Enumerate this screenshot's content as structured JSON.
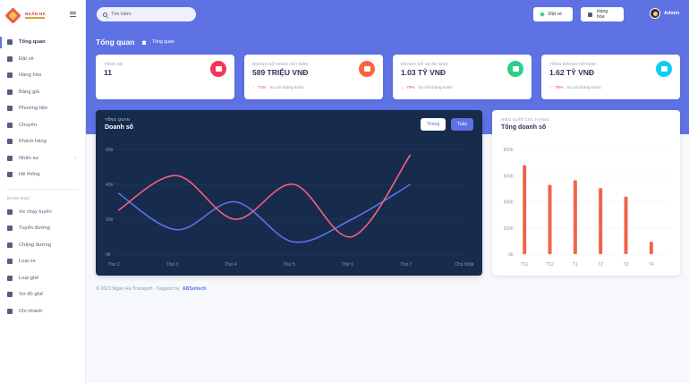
{
  "sidebar": {
    "brand_text": "NGÂN HÀ",
    "items": [
      {
        "label": "Tổng quan",
        "icon": "monitor-icon",
        "active": true
      },
      {
        "label": "Đặt vé",
        "icon": "ticket-icon"
      },
      {
        "label": "Hàng hóa",
        "icon": "box-icon"
      },
      {
        "label": "Bảng giá",
        "icon": "price-list-icon"
      },
      {
        "label": "Phương tiện",
        "icon": "vehicle-icon"
      },
      {
        "label": "Chuyến",
        "icon": "trip-icon"
      },
      {
        "label": "Khách hàng",
        "icon": "customer-icon"
      },
      {
        "label": "Nhân sự",
        "icon": "user-icon",
        "has_children": true
      },
      {
        "label": "Hệ thống",
        "icon": "tools-icon"
      }
    ],
    "catalog_heading": "DANH MỤC",
    "catalog_items": [
      {
        "label": "Xe chạy tuyến",
        "icon": "bus-route-icon"
      },
      {
        "label": "Tuyến đường",
        "icon": "route-icon"
      },
      {
        "label": "Chặng đường",
        "icon": "road-icon"
      },
      {
        "label": "Loại xe",
        "icon": "car-icon"
      },
      {
        "label": "Loại ghế",
        "icon": "seat-icon"
      },
      {
        "label": "Sơ đồ ghế",
        "icon": "seat-map-icon"
      },
      {
        "label": "Chi nhánh",
        "icon": "branch-icon"
      }
    ]
  },
  "header": {
    "search_placeholder": "Tìm kiếm",
    "btn_ticket": "Đặt vé",
    "btn_goods": "Hàng hóa",
    "user_name": "Admin",
    "page_title": "Tổng quan",
    "breadcrumb": "Tổng quan"
  },
  "stats": [
    {
      "label": "Tổng xe",
      "value": "11",
      "color": "#f5365c",
      "icon": "car-icon"
    },
    {
      "label": "Doanh số hàng gửi năm",
      "value": "589 TRIỆU VNĐ",
      "pct": "71%",
      "note": "So với tháng trước",
      "color": "#fb6340",
      "icon": "box-icon"
    },
    {
      "label": "Doanh số vé xe năm",
      "value": "1.03 TỶ VNĐ",
      "pct": "79%",
      "note": "So với tháng trước",
      "color": "#2dce89",
      "icon": "ticket-icon"
    },
    {
      "label": "Tổng doanh số năm",
      "value": "1.62 TỶ VNĐ",
      "pct": "78%",
      "note": "So với tháng trước",
      "color": "#11cdef",
      "icon": "bar-chart-icon"
    }
  ],
  "sales_card": {
    "overline": "TỔNG QUAN",
    "title": "Doanh số",
    "btn_month": "Tháng",
    "btn_week": "Tuần"
  },
  "chart_data": [
    {
      "type": "line",
      "categories": [
        "Thứ 2",
        "Thứ 3",
        "Thứ 4",
        "Thứ 5",
        "Thứ 6",
        "Thứ 7",
        "Chủ Nhật"
      ],
      "yticks": [
        "0tr",
        "20tr",
        "40tr",
        "60tr"
      ],
      "ylim": [
        0,
        60
      ],
      "series": [
        {
          "values": [
            35,
            14,
            30,
            7,
            20,
            40
          ],
          "color": "#5e72e4"
        },
        {
          "values": [
            25,
            45,
            20,
            40,
            10,
            57
          ],
          "color": "#f3607c"
        }
      ],
      "grid": true
    },
    {
      "type": "bar",
      "overline": "HIỆU SUẤT CÁC THÁNG",
      "title": "Tổng doanh số",
      "categories": [
        "T11",
        "T12",
        "T1",
        "T2",
        "T3",
        "T4"
      ],
      "yticks": [
        "0tr",
        "200tr",
        "400tr",
        "600tr",
        "800tr"
      ],
      "ylim": [
        0,
        800
      ],
      "values": [
        680,
        530,
        565,
        505,
        440,
        95
      ],
      "color": "#f0644a",
      "grid": true
    }
  ],
  "footer": {
    "text": "© 2023 Ngan Ha Transport - Support by",
    "link": "ABSoltech"
  }
}
